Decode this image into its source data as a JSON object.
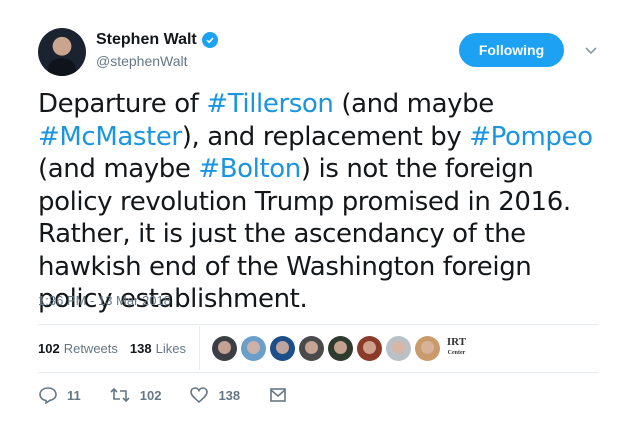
{
  "author": {
    "name": "Stephen Walt",
    "handle": "@stephenWalt",
    "verified": true
  },
  "follow_button": {
    "label": "Following",
    "color": "#1da1f2"
  },
  "tweet": {
    "segments": [
      {
        "text": "Departure of ",
        "hashtag": false
      },
      {
        "text": "#Tillerson",
        "hashtag": true
      },
      {
        "text": " (and maybe ",
        "hashtag": false
      },
      {
        "text": "#McMaster",
        "hashtag": true
      },
      {
        "text": "), and replacement by ",
        "hashtag": false
      },
      {
        "text": "#Pompeo",
        "hashtag": true
      },
      {
        "text": " (and maybe ",
        "hashtag": false
      },
      {
        "text": "#Bolton",
        "hashtag": true
      },
      {
        "text": ") is not the foreign policy revolution Trump promised in 2016.  Rather, it is just the ascendancy of the hawkish end of the Washington foreign policy establishment.",
        "hashtag": false
      }
    ],
    "timestamp": "1:36 PM - 13 Mar 2018"
  },
  "stats": {
    "retweets_count": "102",
    "retweets_label": "Retweets",
    "likes_count": "138",
    "likes_label": "Likes"
  },
  "likers": [
    {
      "name": "liker-avatar-1",
      "color": "#3b3f45"
    },
    {
      "name": "liker-avatar-2",
      "color": "#6a9fc9"
    },
    {
      "name": "liker-avatar-3",
      "color": "#1c4f8a"
    },
    {
      "name": "liker-avatar-4",
      "color": "#4a4a4a"
    },
    {
      "name": "liker-avatar-5",
      "color": "#2e3a2e"
    },
    {
      "name": "liker-avatar-6",
      "color": "#8c3a2a"
    },
    {
      "name": "liker-avatar-7",
      "color": "#b9c0c6"
    },
    {
      "name": "liker-avatar-8",
      "color": "#c99a6a"
    }
  ],
  "liker_logo": {
    "line1": "IRT",
    "line2": "Center"
  },
  "actions": {
    "reply_count": "11",
    "retweet_count": "102",
    "like_count": "138"
  },
  "colors": {
    "hashtag": "#1b95e0",
    "secondary_text": "#657786",
    "divider": "#e6ecf0"
  }
}
